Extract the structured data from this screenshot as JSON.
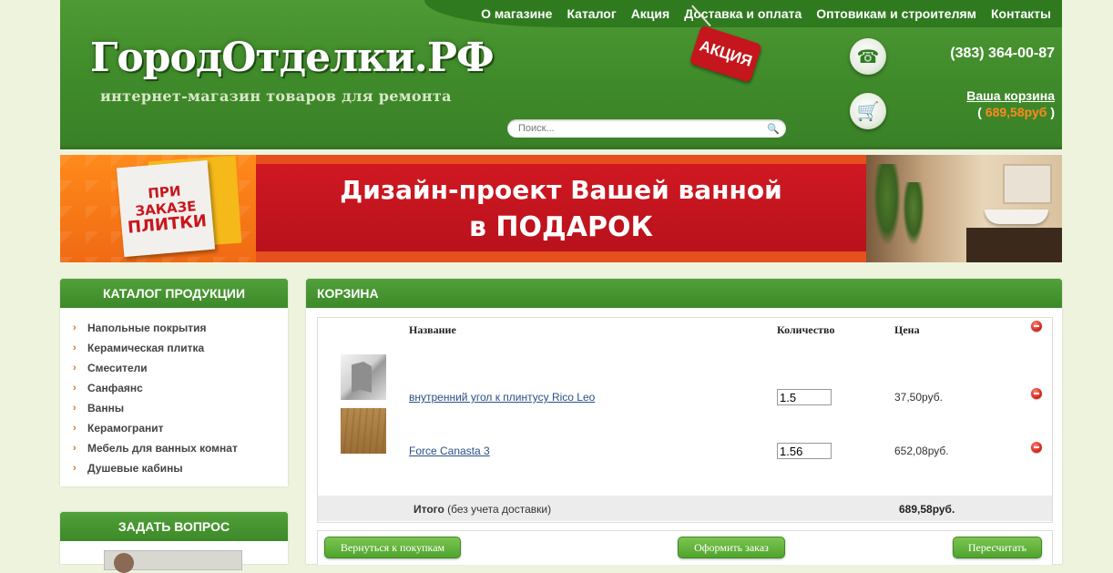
{
  "nav": {
    "items": [
      "О магазине",
      "Каталог",
      "Акция",
      "Доставка и оплата",
      "Оптовикам и строителям",
      "Контакты"
    ]
  },
  "header": {
    "logo": "ГородОтделки.РФ",
    "tagline": "интернет-магазин товаров для ремонта",
    "promo_tag": "АКЦИЯ",
    "search_placeholder": "Поиск...",
    "phone": "(383) 364-00-87",
    "cart_link": "Ваша корзина",
    "cart_total_open": "( ",
    "cart_total_amount": "689,58руб",
    "cart_total_close": " )"
  },
  "banner": {
    "card_text_1": "ПРИ ЗАКАЗЕ",
    "card_text_2": "ПЛИТКИ",
    "line1": "Дизайн-проект Вашей ванной",
    "line2": "в ПОДАРОК"
  },
  "sidebar": {
    "catalog_title": "КАТАЛОГ ПРОДУКЦИИ",
    "categories": [
      "Напольные покрытия",
      "Керамическая плитка",
      "Смесители",
      "Санфаянс",
      "Ванны",
      "Керамогранит",
      "Мебель для ванных комнат",
      "Душевые кабины"
    ],
    "ask_title": "ЗАДАТЬ ВОПРОС"
  },
  "cart": {
    "title": "КОРЗИНА",
    "columns": {
      "name": "Название",
      "qty": "Количество",
      "price": "Цена"
    },
    "items": [
      {
        "name": "внутренний угол к плинтусу Rico Leo",
        "qty": "1.5",
        "price": "37,50руб."
      },
      {
        "name": "Force Canasta 3",
        "qty": "1.56",
        "price": "652,08руб."
      }
    ],
    "total_label_bold": "Итого",
    "total_label_rest": " (без учета доставки)",
    "total_value": "689,58руб.",
    "buttons": {
      "back": "Вернуться к покупкам",
      "checkout": "Оформить заказ",
      "recalc": "Пересчитать"
    }
  },
  "colors": {
    "header_green": "#3f8a2a",
    "accent_orange": "#ff8a1e",
    "banner_red": "#c8161e",
    "link_blue": "#2a4f86"
  }
}
